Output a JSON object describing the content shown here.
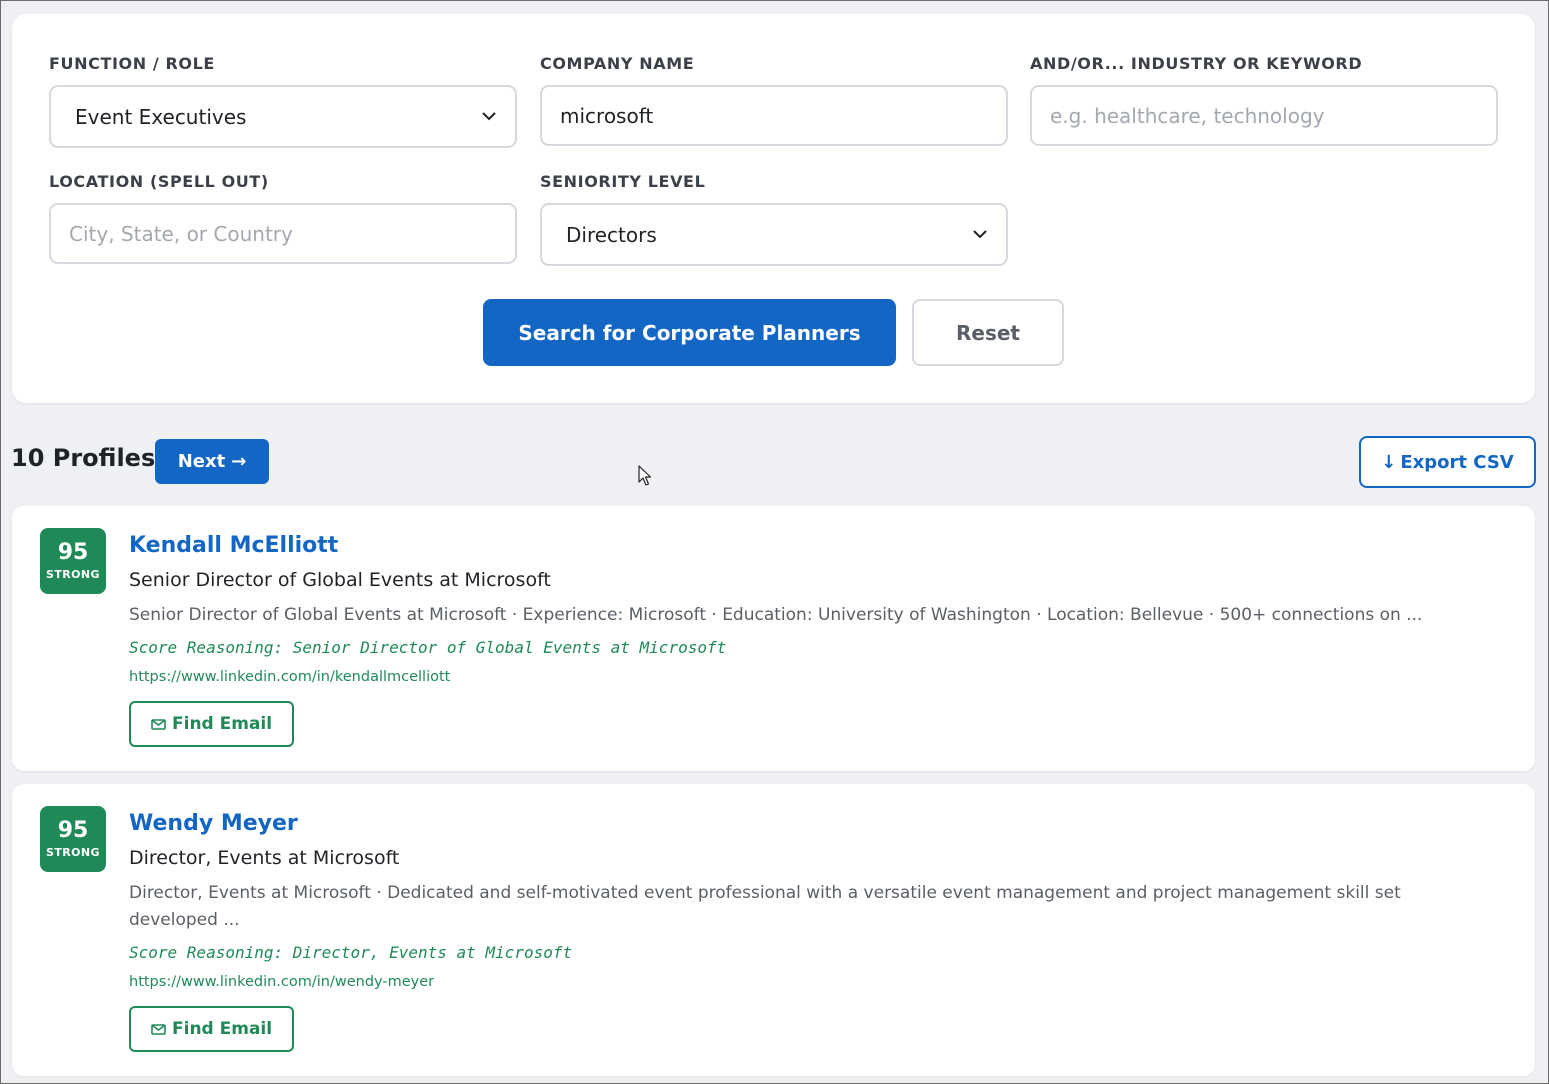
{
  "filters": {
    "function_role": {
      "label": "FUNCTION / ROLE",
      "value": "Event Executives"
    },
    "company_name": {
      "label": "COMPANY NAME",
      "value": "microsoft"
    },
    "industry": {
      "label": "AND/OR... INDUSTRY OR KEYWORD",
      "placeholder": "e.g. healthcare, technology"
    },
    "location": {
      "label": "LOCATION (SPELL OUT)",
      "placeholder": "City, State, or Country"
    },
    "seniority": {
      "label": "SENIORITY LEVEL",
      "value": "Directors"
    },
    "search_label": "Search for Corporate Planners",
    "reset_label": "Reset"
  },
  "results": {
    "count_label": "10 Profiles",
    "next_label": "Next",
    "next_arrow": "→",
    "export_icon": "↓",
    "export_label": "Export CSV"
  },
  "profiles": [
    {
      "score": "95",
      "score_label": "STRONG",
      "name": "Kendall McElliott",
      "title": "Senior Director of Global Events at Microsoft",
      "snippet": "Senior Director of Global Events at Microsoft · Experience: Microsoft · Education: University of Washington · Location: Bellevue · 500+ connections on ...",
      "reasoning": "Score Reasoning: Senior Director of Global Events at Microsoft",
      "url": "https://www.linkedin.com/in/kendallmcelliott",
      "email_label": "Find Email"
    },
    {
      "score": "95",
      "score_label": "STRONG",
      "name": "Wendy Meyer",
      "title": "Director, Events at Microsoft",
      "snippet": "Director, Events at Microsoft · Dedicated and self-motivated event professional with a versatile event management and project management skill set developed ...",
      "reasoning": "Score Reasoning: Director, Events at Microsoft",
      "url": "https://www.linkedin.com/in/wendy-meyer",
      "email_label": "Find Email"
    }
  ],
  "colors": {
    "primary": "#1366c4",
    "score_green": "#1f8a57",
    "background": "#eef0f4"
  },
  "icons": [
    "chevron-down-icon",
    "arrow-right-icon",
    "download-icon",
    "mail-icon",
    "cursor-icon"
  ]
}
